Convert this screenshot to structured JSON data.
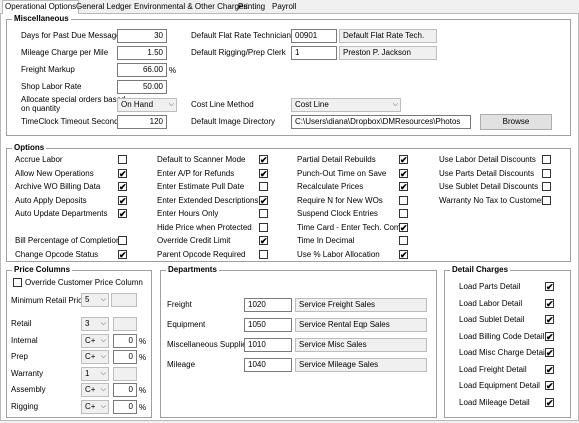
{
  "tabs": [
    "Operational Options",
    "General Ledger",
    "Environmental & Other Charges",
    "Printing",
    "Payroll"
  ],
  "misc": {
    "title": "Miscellaneous",
    "days_label": "Days for Past Due Message",
    "days_value": "30",
    "mileage_label": "Mileage Charge per Mile",
    "mileage_value": "1.50",
    "freight_label": "Freight Markup",
    "freight_value": "66.00",
    "freight_unit": "%",
    "shop_label": "Shop Labor Rate",
    "shop_value": "50.00",
    "allocate_label_1": "Allocate special orders based",
    "allocate_label_2": "on quantity",
    "allocate_value": "On Hand",
    "timeclock_label": "TimeClock Timeout Seconds",
    "timeclock_value": "120",
    "flat_rate_label": "Default Flat Rate Technician",
    "flat_rate_code": "00901",
    "flat_rate_name": "Default Flat Rate Tech.",
    "rigging_label": "Default Rigging/Prep Clerk",
    "rigging_code": "1",
    "rigging_name": "Preston P. Jackson",
    "cost_method_label": "Cost Line Method",
    "cost_method_value": "Cost Line",
    "image_dir_label": "Default Image Directory",
    "image_dir_value": "C:\\Users\\diana\\Dropbox\\DMResources\\Photos",
    "browse_label": "Browse"
  },
  "options": {
    "title": "Options",
    "col1": [
      {
        "label": "Accrue Labor",
        "checked": false
      },
      {
        "label": "Allow New Operations",
        "checked": true
      },
      {
        "label": "Archive WO Billing Data",
        "checked": true
      },
      {
        "label": "Auto Apply Deposits",
        "checked": true
      },
      {
        "label": "Auto Update Departments",
        "checked": true
      },
      {
        "label": "",
        "checked": null
      },
      {
        "label": "Bill Percentage of Completion",
        "checked": false
      },
      {
        "label": "Change Opcode Status",
        "checked": true
      }
    ],
    "col2": [
      {
        "label": "Default to Scanner Mode",
        "checked": true
      },
      {
        "label": "Enter A/P for Refunds",
        "checked": true
      },
      {
        "label": "Enter Estimate Pull Date",
        "checked": false
      },
      {
        "label": "Enter Extended Descriptions",
        "checked": true
      },
      {
        "label": "Enter Hours Only",
        "checked": false
      },
      {
        "label": "Hide Price when Protected",
        "checked": false
      },
      {
        "label": "Override Credit Limit",
        "checked": true
      },
      {
        "label": "Parent Opcode Required",
        "checked": false
      }
    ],
    "col3": [
      {
        "label": "Partial Detail Rebuilds",
        "checked": true
      },
      {
        "label": "Punch-Out Time on Save",
        "checked": true
      },
      {
        "label": "Recalculate Prices",
        "checked": true
      },
      {
        "label": "Require N for New WOs",
        "checked": false
      },
      {
        "label": "Suspend Clock Entries",
        "checked": false
      },
      {
        "label": "Time Card - Enter Tech. Com.",
        "checked": true
      },
      {
        "label": "Time In Decimal",
        "checked": false
      },
      {
        "label": "Use % Labor Allocation",
        "checked": true
      }
    ],
    "col4": [
      {
        "label": "Use Labor Detail Discounts",
        "checked": false
      },
      {
        "label": "Use Parts Detail Discounts",
        "checked": false
      },
      {
        "label": "Use Sublet Detail Discounts",
        "checked": false
      },
      {
        "label": "Warranty No Tax to Customer",
        "checked": false
      }
    ]
  },
  "price": {
    "title": "Price Columns",
    "override_label": "Override Customer Price Column",
    "min_label": "Minimum Retail Price",
    "min_value": "5",
    "rows": [
      {
        "label": "Retail",
        "value": "3",
        "pct": null
      },
      {
        "label": "Internal",
        "value": "C+",
        "pct": "0"
      },
      {
        "label": "Prep",
        "value": "C+",
        "pct": "0"
      },
      {
        "label": "Warranty",
        "value": "1",
        "pct": null
      },
      {
        "label": "Assembly",
        "value": "C+",
        "pct": "0"
      },
      {
        "label": "Rigging",
        "value": "C+",
        "pct": "0"
      }
    ],
    "pct_unit": "%"
  },
  "departments": {
    "title": "Departments",
    "rows": [
      {
        "label": "Freight",
        "code": "1020",
        "name": "Service Freight Sales"
      },
      {
        "label": "Equipment",
        "code": "1050",
        "name": "Service Rental Eqp Sales"
      },
      {
        "label": "Miscellaneous Supplies",
        "code": "1010",
        "name": "Service Misc Sales"
      },
      {
        "label": "Mileage",
        "code": "1040",
        "name": "Service Mileage Sales"
      }
    ]
  },
  "detail": {
    "title": "Detail Charges",
    "rows": [
      {
        "label": "Load Parts Detail",
        "checked": true
      },
      {
        "label": "Load Labor Detail",
        "checked": true
      },
      {
        "label": "Load Sublet Detail",
        "checked": true
      },
      {
        "label": "Load Billing Code Detail",
        "checked": true
      },
      {
        "label": "Load Misc Charge Detail",
        "checked": true
      },
      {
        "label": "Load Freight Detail",
        "checked": true
      },
      {
        "label": "Load Equipment Detail",
        "checked": true
      },
      {
        "label": "Load Mileage Detail",
        "checked": true
      }
    ]
  },
  "check_glyph": "✔"
}
